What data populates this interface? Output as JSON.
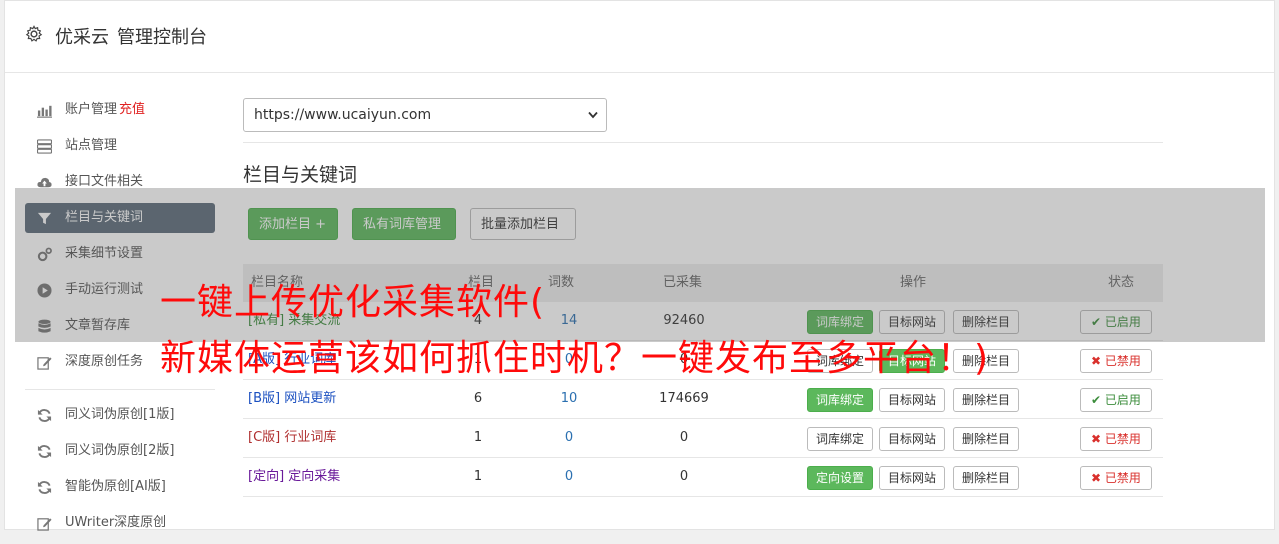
{
  "header": {
    "brand": "优采云",
    "title": "管理控制台"
  },
  "sidebar": {
    "items": [
      {
        "label": "账户管理",
        "extra": "充值",
        "icon": "bar-chart-icon"
      },
      {
        "label": "站点管理",
        "icon": "server-icon"
      },
      {
        "label": "接口文件相关",
        "icon": "cloud-upload-icon"
      },
      {
        "label": "栏目与关键词",
        "icon": "filter-icon",
        "active": true
      },
      {
        "label": "采集细节设置",
        "icon": "cogs-icon"
      },
      {
        "label": "手动运行测试",
        "icon": "play-circle-icon"
      },
      {
        "label": "文章暂存库",
        "icon": "database-icon"
      },
      {
        "label": "深度原创任务",
        "icon": "edit-icon"
      }
    ],
    "items2": [
      {
        "label": "同义词伪原创[1版]",
        "icon": "refresh-icon"
      },
      {
        "label": "同义词伪原创[2版]",
        "icon": "refresh-icon"
      },
      {
        "label": "智能伪原创[AI版]",
        "icon": "refresh-icon"
      },
      {
        "label": "UWriter深度原创",
        "icon": "edit-icon"
      }
    ]
  },
  "main": {
    "site_select": "https://www.ucaiyun.com",
    "section_title": "栏目与关键词",
    "buttons": {
      "add_column": "添加栏目 +",
      "private_lib": "私有词库管理",
      "batch_add": "批量添加栏目"
    },
    "table": {
      "headers": {
        "name": "栏目名称",
        "col2": "栏目",
        "col3": "词数",
        "collected": "已采集",
        "ops": "操作",
        "status": "状态"
      },
      "rows": [
        {
          "tag": "[私有]",
          "name": "采集交流",
          "a": "4",
          "b": "14",
          "c": "92460",
          "op1": "词库绑定",
          "op1_green": true,
          "op2": "目标网站",
          "op3": "删除栏目",
          "status": "已启用",
          "on": true,
          "tagclass": "tag-green"
        },
        {
          "tag": "[A版]",
          "name": "行业词库",
          "a": "1",
          "b": "0",
          "c": "0",
          "op1": "词库绑定",
          "op1_green": false,
          "op2": "目标网站",
          "op2_green": true,
          "op3": "删除栏目",
          "status": "已禁用",
          "on": false,
          "tagclass": "tag-blue"
        },
        {
          "tag": "[B版]",
          "name": "网站更新",
          "a": "6",
          "b": "10",
          "c": "174669",
          "op1": "词库绑定",
          "op1_green": true,
          "op2": "目标网站",
          "op3": "删除栏目",
          "status": "已启用",
          "on": true,
          "tagclass": "tag-blue"
        },
        {
          "tag": "[C版]",
          "name": "行业词库",
          "a": "1",
          "b": "0",
          "c": "0",
          "op1": "词库绑定",
          "op1_green": false,
          "op2": "目标网站",
          "op3": "删除栏目",
          "status": "已禁用",
          "on": false,
          "tagclass": "tag-red"
        },
        {
          "tag": "[定向]",
          "name": "定向采集",
          "a": "1",
          "b": "0",
          "c": "0",
          "op1": "定向设置",
          "op1_green": true,
          "op2": "目标网站",
          "op3": "删除栏目",
          "status": "已禁用",
          "on": false,
          "tagclass": "tag-purple"
        }
      ]
    }
  },
  "overlay": {
    "line1": "一键上传优化采集软件(",
    "line2": "新媒体运营该如何抓住时机？一键发布至多平台！)"
  }
}
